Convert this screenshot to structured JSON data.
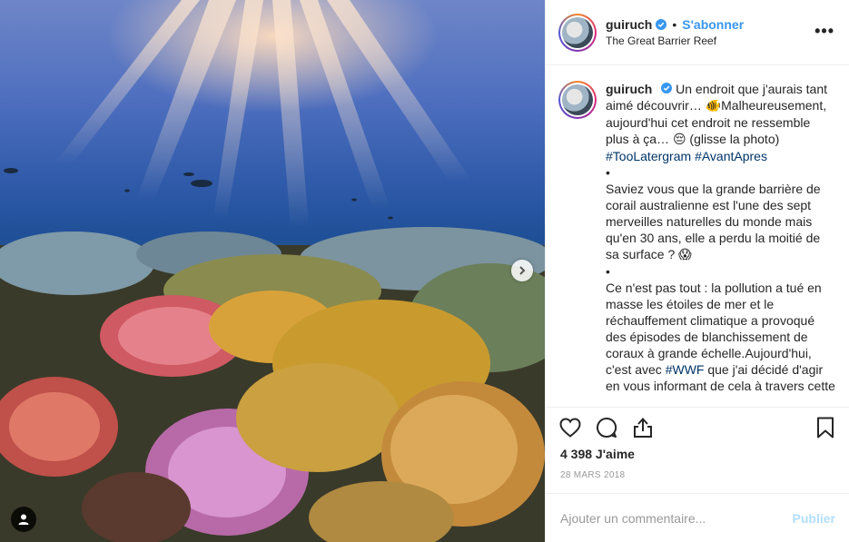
{
  "post": {
    "username": "guiruch",
    "verified_icon": "verified-badge-icon",
    "separator": "•",
    "follow_label": "S'abonner",
    "location": "The Great Barrier Reef",
    "more_icon": "more-options-icon",
    "more_label": "•••"
  },
  "caption": {
    "username": "guiruch",
    "segments": [
      {
        "type": "text",
        "value": "Un endroit que j'aurais tant aimé découvrir… "
      },
      {
        "type": "emoji",
        "value": "🐠"
      },
      {
        "type": "text",
        "value": "Malheureusement, aujourd'hui cet endroit ne ressemble plus à ça… "
      },
      {
        "type": "emoji",
        "value": "😔"
      },
      {
        "type": "text",
        "value": " (glisse la photo) "
      },
      {
        "type": "hashtag",
        "value": "#TooLatergram"
      },
      {
        "type": "text",
        "value": " "
      },
      {
        "type": "hashtag",
        "value": "#AvantApres"
      },
      {
        "type": "break"
      },
      {
        "type": "text",
        "value": "•"
      },
      {
        "type": "break"
      },
      {
        "type": "text",
        "value": "Saviez vous que la grande barrière de corail australienne est l'une des sept merveilles naturelles du monde mais qu'en 30 ans, elle a perdu la moitié de sa surface ? "
      },
      {
        "type": "emoji",
        "value": "😱"
      },
      {
        "type": "break"
      },
      {
        "type": "text",
        "value": "•"
      },
      {
        "type": "break"
      },
      {
        "type": "text",
        "value": "Ce n'est pas tout : la pollution a tué en masse les étoiles de mer et le réchauffement climatique a provoqué des épisodes de blanchissement de coraux à grande échelle.Aujourd'hui, c'est avec "
      },
      {
        "type": "hashtag",
        "value": "#WWF"
      },
      {
        "type": "text",
        "value": " que j'ai décidé d'agir en vous informant de cela à travers cette petite publication, but"
      }
    ]
  },
  "actions": {
    "like_icon": "heart-icon",
    "comment_icon": "comment-icon",
    "share_icon": "share-icon",
    "save_icon": "bookmark-icon"
  },
  "likes": "4 398 J'aime",
  "date": "28 MARS 2018",
  "comment": {
    "placeholder": "Ajouter un commentaire...",
    "publish_label": "Publier"
  },
  "media": {
    "next_icon": "chevron-right-icon",
    "tag_icon": "user-tag-icon"
  },
  "colors": {
    "accent": "#3897f0",
    "hashtag": "#003569",
    "publish_disabled": "#b2dffc",
    "muted": "#999999"
  }
}
